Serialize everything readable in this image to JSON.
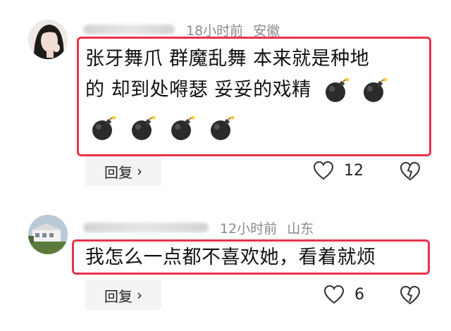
{
  "comments": [
    {
      "time": "18小时前",
      "location": "安徽",
      "text_line1": "张牙舞爪 群魔乱舞 本来就是种地",
      "text_line2": "的 却到处嘚瑟 妥妥的戏精",
      "emoji": "bomb-emoji",
      "emoji_count": 6,
      "reply_label": "回复",
      "like_count": "12",
      "highlight_color": "#e8334a"
    },
    {
      "time": "12小时前",
      "location": "山东",
      "text_line1": "我怎么一点都不喜欢她，看着就烦",
      "reply_label": "回复",
      "like_count": "6",
      "highlight_color": "#e8334a"
    }
  ]
}
